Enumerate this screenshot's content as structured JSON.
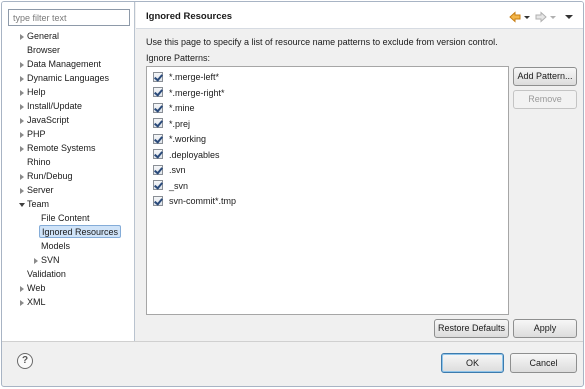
{
  "filter": {
    "placeholder": "type filter text"
  },
  "tree": [
    {
      "label": "General",
      "expander": "right"
    },
    {
      "label": "Browser",
      "expander": ""
    },
    {
      "label": "Data Management",
      "expander": "right"
    },
    {
      "label": "Dynamic Languages",
      "expander": "right"
    },
    {
      "label": "Help",
      "expander": "right"
    },
    {
      "label": "Install/Update",
      "expander": "right"
    },
    {
      "label": "JavaScript",
      "expander": "right"
    },
    {
      "label": "PHP",
      "expander": "right"
    },
    {
      "label": "Remote Systems",
      "expander": "right"
    },
    {
      "label": "Rhino",
      "expander": ""
    },
    {
      "label": "Run/Debug",
      "expander": "right"
    },
    {
      "label": "Server",
      "expander": "right"
    },
    {
      "label": "Team",
      "expander": "down"
    },
    {
      "label": "File Content",
      "expander": ""
    },
    {
      "label": "Ignored Resources",
      "expander": "",
      "selected": true
    },
    {
      "label": "Models",
      "expander": ""
    },
    {
      "label": "SVN",
      "expander": "right"
    },
    {
      "label": "Validation",
      "expander": ""
    },
    {
      "label": "Web",
      "expander": "right"
    },
    {
      "label": "XML",
      "expander": "right"
    }
  ],
  "page": {
    "title": "Ignored Resources",
    "description": "Use this page to specify a list of resource name patterns to exclude from version control.",
    "patterns_label": "Ignore Patterns:"
  },
  "patterns": [
    {
      "text": "*.merge-left*",
      "checked": true
    },
    {
      "text": "*.merge-right*",
      "checked": true
    },
    {
      "text": "*.mine",
      "checked": true
    },
    {
      "text": "*.prej",
      "checked": true
    },
    {
      "text": "*.working",
      "checked": true
    },
    {
      "text": ".deployables",
      "checked": true
    },
    {
      "text": ".svn",
      "checked": true
    },
    {
      "text": "_svn",
      "checked": true
    },
    {
      "text": "svn-commit*.tmp",
      "checked": true
    }
  ],
  "buttons": {
    "add_pattern": "Add Pattern...",
    "remove": "Remove",
    "restore_defaults": "Restore Defaults",
    "apply": "Apply",
    "ok": "OK",
    "cancel": "Cancel",
    "help": "?"
  },
  "colors": {
    "selection": "#cfe3f8",
    "accent": "#3d7bad",
    "nav_arrow": "#e8a33a"
  },
  "icons": {
    "back": "arrow-left-icon",
    "forward": "arrow-right-icon",
    "menu": "view-menu-icon",
    "help": "help-icon"
  }
}
